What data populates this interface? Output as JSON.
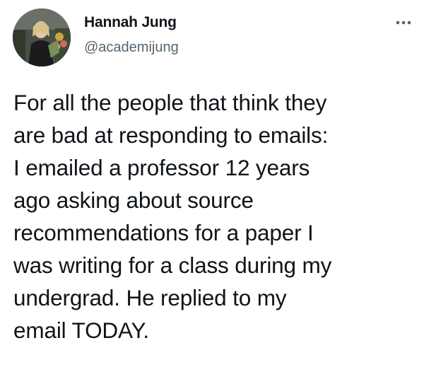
{
  "author": {
    "display_name": "Hannah Jung",
    "handle": "@academijung"
  },
  "icons": {
    "avatar": "profile-photo",
    "more": "more-horizontal-icon"
  },
  "colors": {
    "text_primary": "#0f1419",
    "text_secondary": "#536471"
  },
  "tweet": {
    "lines": [
      "For all the people that think they",
      "are bad at responding to emails:",
      "I emailed a professor 12 years",
      "ago asking about source",
      "recommendations for a paper I",
      "was writing for a class during my",
      "undergrad. He replied to my",
      "email TODAY."
    ]
  }
}
